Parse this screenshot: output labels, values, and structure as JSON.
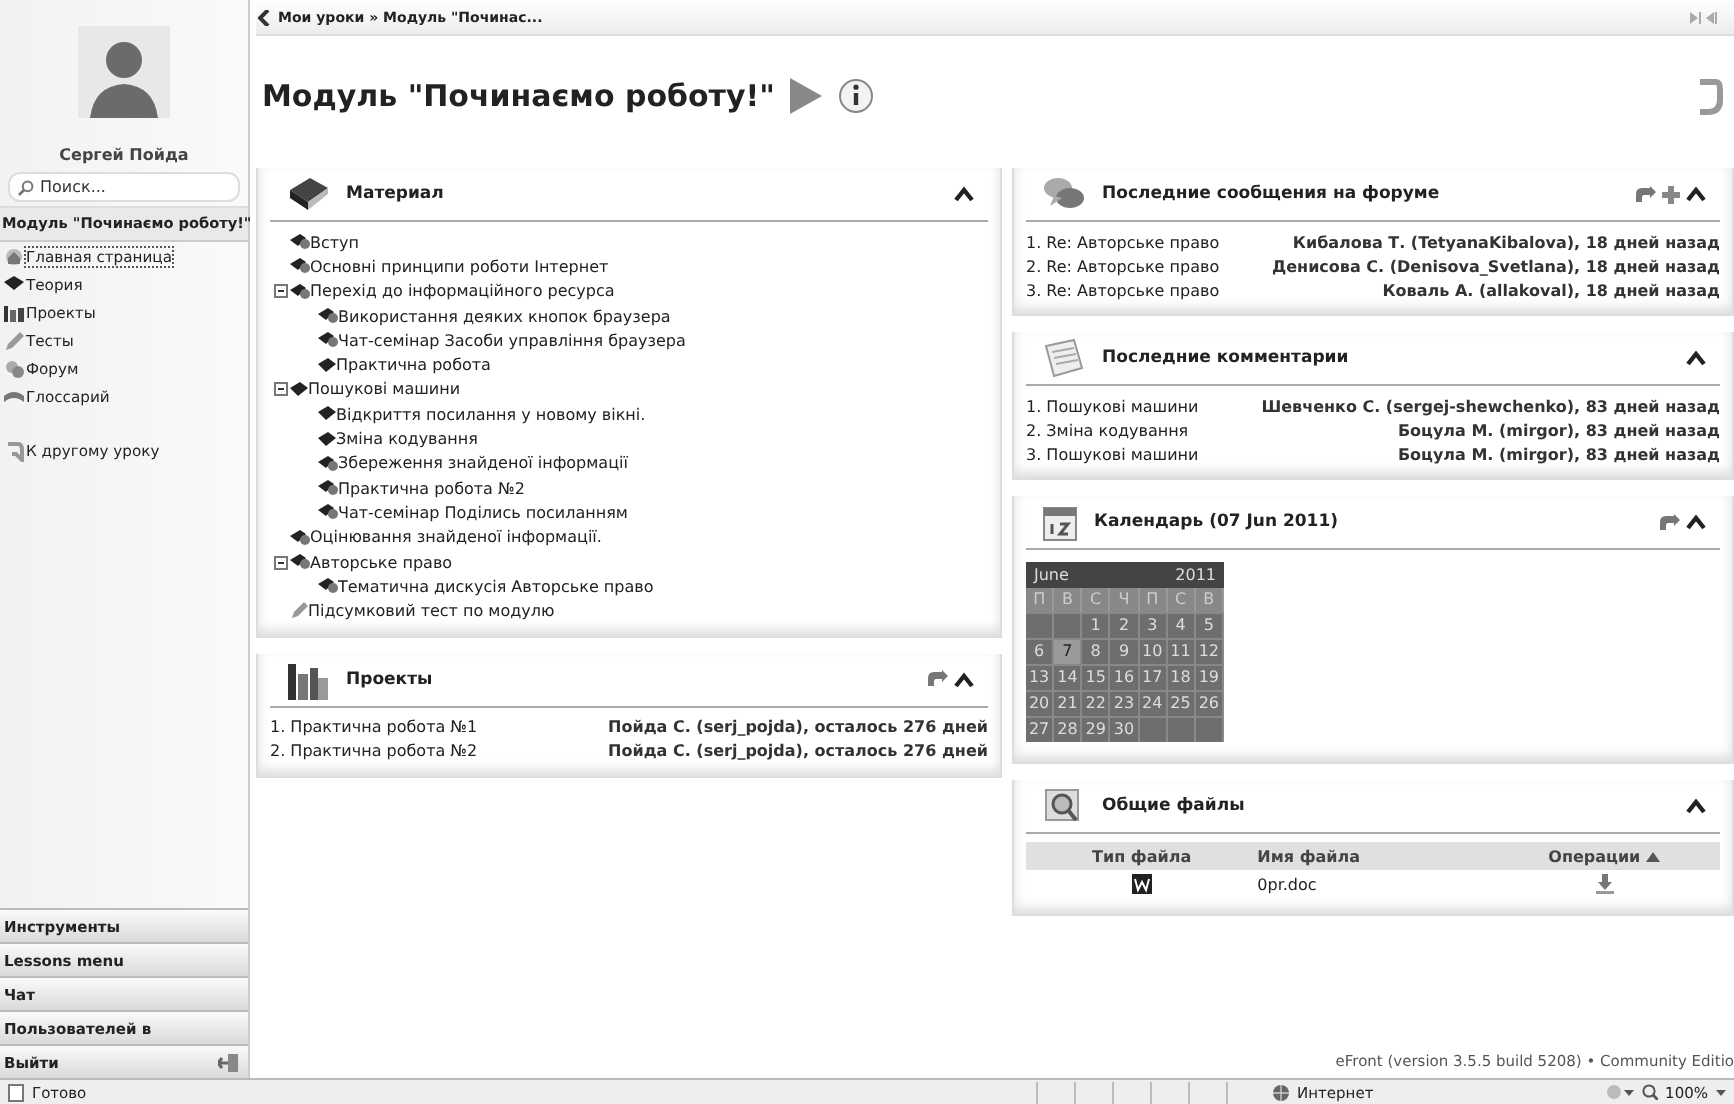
{
  "breadcrumb": "Мои уроки » Модуль \"Починас...",
  "page_title": "Модуль \"Починаємо роботу!\"",
  "sidebar": {
    "user_name": "Сергей Пойда",
    "search": {
      "placeholder": "Поиск..."
    },
    "module_title": "Модуль \"Починаємо роботу!\"",
    "items": [
      {
        "kind": "home",
        "label": "Главная страница",
        "selected": true
      },
      {
        "kind": "theory",
        "label": "Теория",
        "selected": false
      },
      {
        "kind": "projects",
        "label": "Проекты",
        "selected": false
      },
      {
        "kind": "tests",
        "label": "Тесты",
        "selected": false
      },
      {
        "kind": "forum",
        "label": "Форум",
        "selected": false
      },
      {
        "kind": "glossary",
        "label": "Глоссарий",
        "selected": false
      }
    ],
    "other_lesson": "К другому уроку",
    "bottom_bars": [
      {
        "label": "Инструменты"
      },
      {
        "label": "Lessons menu"
      },
      {
        "label": "Чат"
      },
      {
        "label": "Пользователей в"
      },
      {
        "label": "Выйти",
        "kind": "exit"
      }
    ]
  },
  "materials": {
    "title": "Материал",
    "tree": [
      {
        "label": "Вступ",
        "kind": "unit"
      },
      {
        "label": "Основні принципи роботи Інтернет",
        "kind": "unit"
      },
      {
        "label": "Перехід до інформаційного ресурса",
        "kind": "unit",
        "expanded": true,
        "children": [
          {
            "label": "Використання деяких кнопок браузера",
            "kind": "unit"
          },
          {
            "label": "Чат-семінар Засоби управління браузера",
            "kind": "unit"
          },
          {
            "label": "Практична робота",
            "kind": "theory"
          }
        ]
      },
      {
        "label": "Пошукові машини",
        "kind": "theory",
        "expanded": true,
        "children": [
          {
            "label": "Відкриття посилання у новому вікні.",
            "kind": "theory"
          },
          {
            "label": "Зміна кодування",
            "kind": "theory"
          },
          {
            "label": "Збереження знайденої інформації",
            "kind": "unit"
          },
          {
            "label": "Практична робота №2",
            "kind": "unit"
          },
          {
            "label": "Чат-семінар Поділись посиланням",
            "kind": "unit"
          }
        ]
      },
      {
        "label": "Оцінювання знайденої інформації.",
        "kind": "unit"
      },
      {
        "label": "Авторське право",
        "kind": "unit",
        "expanded": true,
        "children": [
          {
            "label": "Тематична дискусія Авторське право",
            "kind": "unit"
          }
        ]
      },
      {
        "label": "Підсумковий тест по модулю",
        "kind": "test"
      }
    ]
  },
  "projects": {
    "title": "Проекты",
    "rows": [
      {
        "name": "1. Практична робота №1",
        "info": "Пойда С. (serj_pojda), осталось 276 дней"
      },
      {
        "name": "2. Практична робота №2",
        "info": "Пойда С. (serj_pojda), осталось 276 дней"
      }
    ]
  },
  "forum": {
    "title": "Последние сообщения на форуме",
    "rows": [
      {
        "topic": "1. Re: Авторське право",
        "info": "Кибалова Т. (TetyanaKibalova), 18 дней назад"
      },
      {
        "topic": "2. Re: Авторське право",
        "info": "Денисова С. (Denisova_Svetlana), 18 дней назад"
      },
      {
        "topic": "3. Re: Авторське право",
        "info": "Коваль А. (allakoval), 18 дней назад"
      }
    ]
  },
  "comments": {
    "title": "Последние комментарии",
    "rows": [
      {
        "topic": "1. Пошукові машини",
        "info": "Шевченко С. (sergej-shewchenko), 83 дней назад"
      },
      {
        "topic": "2. Зміна кодування",
        "info": "Боцула М. (mirgor), 83 дней назад"
      },
      {
        "topic": "3. Пошукові машини",
        "info": "Боцула М. (mirgor), 83 дней назад"
      }
    ]
  },
  "calendar": {
    "title": "Календарь (07 Jun 2011)",
    "month": "June",
    "year": "2011",
    "weekdays": [
      "П",
      "В",
      "С",
      "Ч",
      "П",
      "С",
      "В"
    ],
    "weeks": [
      [
        {
          "kind": "blank"
        },
        {
          "kind": "blank"
        },
        {
          "day": "1",
          "selected": false
        },
        {
          "day": "2",
          "selected": false
        },
        {
          "day": "3",
          "selected": false
        },
        {
          "day": "4",
          "selected": false
        },
        {
          "day": "5",
          "selected": false
        }
      ],
      [
        {
          "day": "6",
          "selected": false
        },
        {
          "day": "7",
          "selected": true
        },
        {
          "day": "8",
          "selected": false
        },
        {
          "day": "9",
          "selected": false
        },
        {
          "day": "10",
          "selected": false
        },
        {
          "day": "11",
          "selected": false
        },
        {
          "day": "12",
          "selected": false
        }
      ],
      [
        {
          "day": "13",
          "selected": false
        },
        {
          "day": "14",
          "selected": false
        },
        {
          "day": "15",
          "selected": false
        },
        {
          "day": "16",
          "selected": false
        },
        {
          "day": "17",
          "selected": false
        },
        {
          "day": "18",
          "selected": false
        },
        {
          "day": "19",
          "selected": false
        }
      ],
      [
        {
          "day": "20",
          "selected": false
        },
        {
          "day": "21",
          "selected": false
        },
        {
          "day": "22",
          "selected": false
        },
        {
          "day": "23",
          "selected": false
        },
        {
          "day": "24",
          "selected": false
        },
        {
          "day": "25",
          "selected": false
        },
        {
          "day": "26",
          "selected": false
        }
      ],
      [
        {
          "day": "27",
          "selected": false
        },
        {
          "day": "28",
          "selected": false
        },
        {
          "day": "29",
          "selected": false
        },
        {
          "day": "30",
          "selected": false
        },
        {
          "kind": "blank"
        },
        {
          "kind": "blank"
        },
        {
          "kind": "blank"
        }
      ]
    ]
  },
  "files": {
    "title": "Общие файлы",
    "columns": [
      "Тип файла",
      "Имя файла",
      "Операции"
    ],
    "rows": [
      {
        "name": "0pr.doc"
      }
    ]
  },
  "footer": "eFront (version 3.5.5 build 5208) • Community Editio",
  "status_bar": {
    "status": "Готово",
    "zone": "Интернет",
    "zoom": "100%"
  }
}
